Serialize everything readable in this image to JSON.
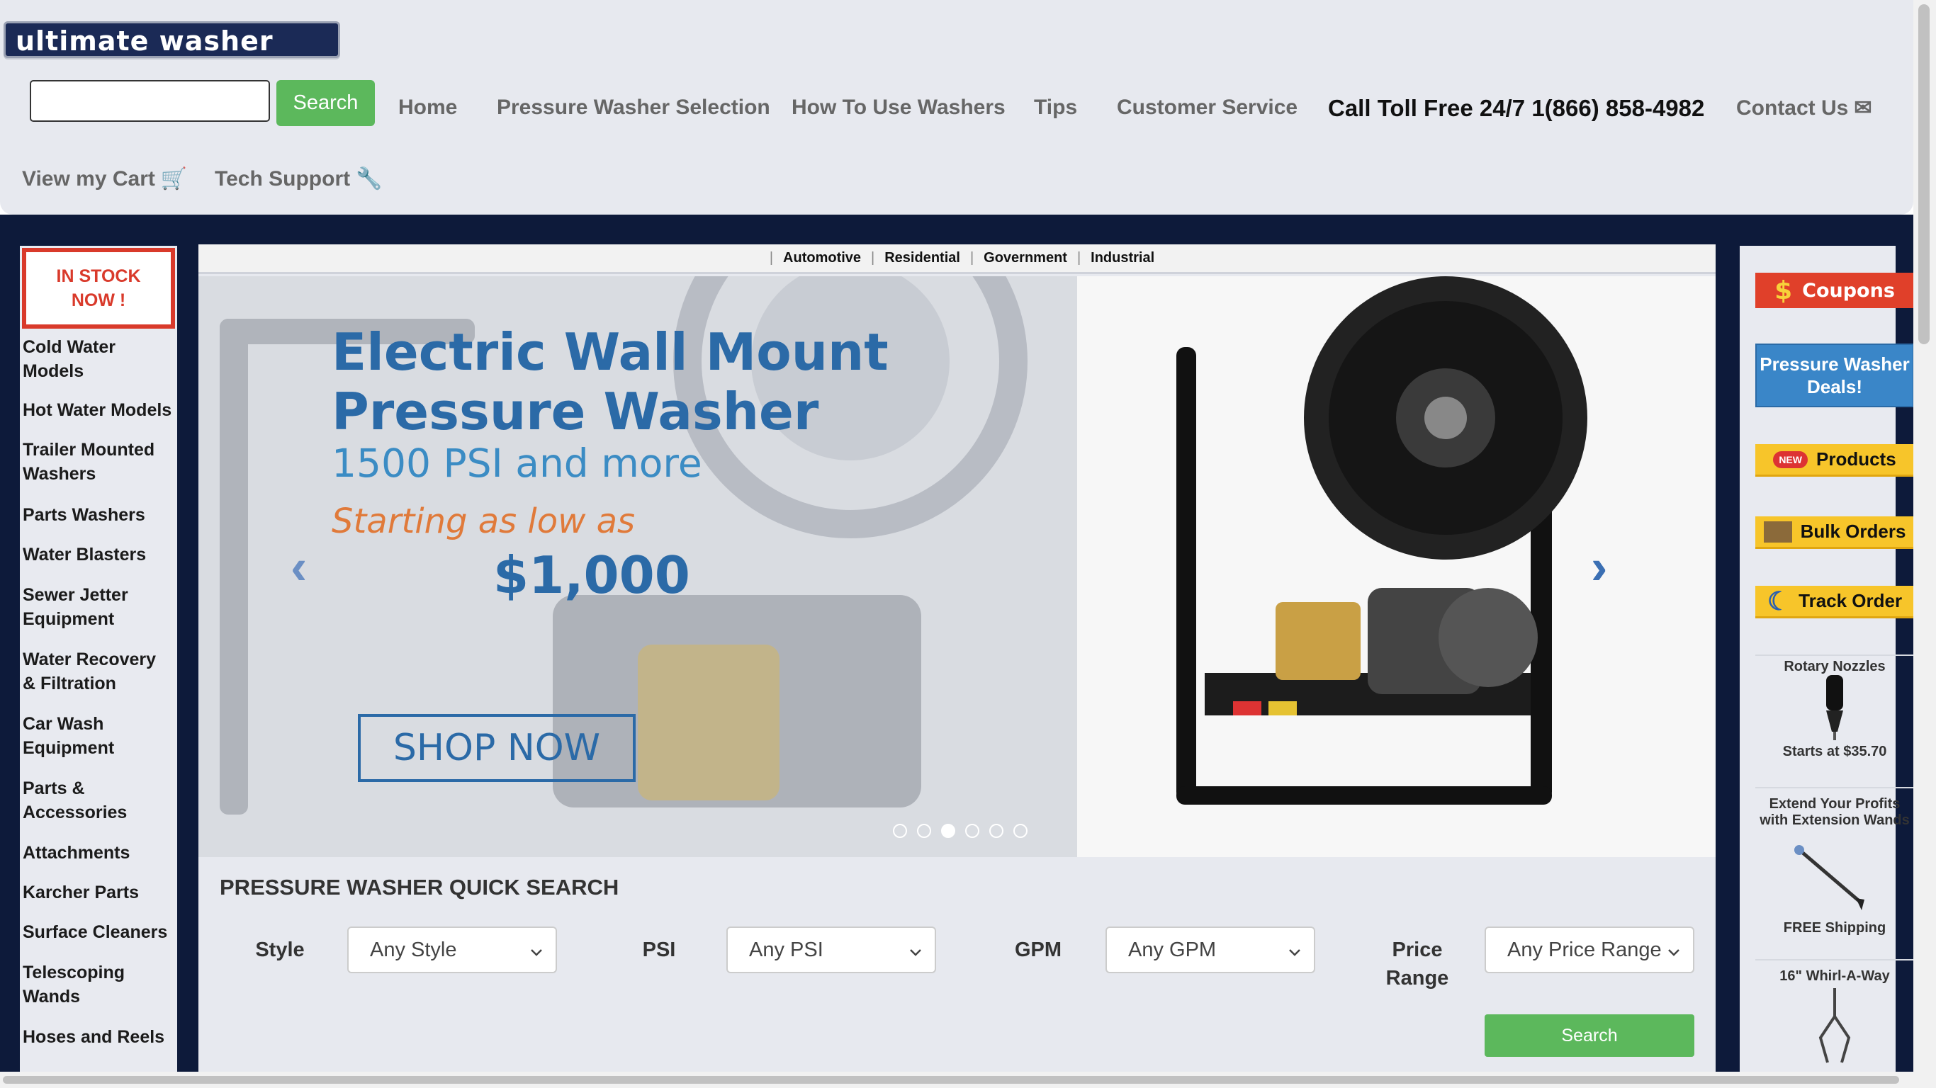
{
  "header": {
    "logo_text": "ultimate washer",
    "search_button": "Search",
    "nav": [
      "Home",
      "Pressure Washer Selection",
      "How To Use Washers",
      "Tips",
      "Customer Service"
    ],
    "phone": "Call Toll Free 24/7 1(866) 858-4982",
    "contact": "Contact Us",
    "cart": "View my Cart",
    "tech_support": "Tech Support"
  },
  "left_sidebar": {
    "instock": "IN STOCK NOW !",
    "links": [
      "Cold Water Models",
      "Hot Water Models",
      "Trailer Mounted Washers",
      "Parts Washers",
      "Water Blasters",
      "Sewer Jetter Equipment",
      "Water Recovery & Filtration",
      "Car Wash Equipment",
      "Parts & Accessories",
      "Attachments",
      "Karcher Parts",
      "Surface Cleaners",
      "Telescoping Wands",
      "Hoses and Reels"
    ]
  },
  "categories": [
    "Automotive",
    "Residential",
    "Government",
    "Industrial"
  ],
  "hero": {
    "title": "Electric Wall Mount Pressure Washer",
    "subtitle": "1500 PSI and more",
    "starting": "Starting as low as",
    "price": "$1,000",
    "cta": "SHOP NOW",
    "active_slide": 2,
    "slide_count": 6
  },
  "quick_search": {
    "title": "PRESSURE WASHER QUICK SEARCH",
    "style_label": "Style",
    "style_value": "Any Style",
    "psi_label": "PSI",
    "psi_value": "Any PSI",
    "gpm_label": "GPM",
    "gpm_value": "Any GPM",
    "price_label": "Price Range",
    "price_value": "Any Price Range",
    "search_button": "Search"
  },
  "right_sidebar": {
    "coupons": "Coupons",
    "deals": "Pressure Washer Deals!",
    "products": "Products",
    "products_badge": "NEW",
    "bulk": "Bulk Orders",
    "track": "Track Order",
    "rotary_title": "Rotary Nozzles",
    "rotary_price": "Starts at $35.70",
    "wands_title": "Extend Your Profits with Extension Wands",
    "wands_shipping": "FREE Shipping",
    "whirl": "16\" Whirl-A-Way"
  },
  "colors": {
    "header_bg": "#e7e9ef",
    "band": "#0d1a3a",
    "green": "#5cb85c",
    "accent_blue": "#2b6aa7",
    "red": "#d93a2b"
  }
}
